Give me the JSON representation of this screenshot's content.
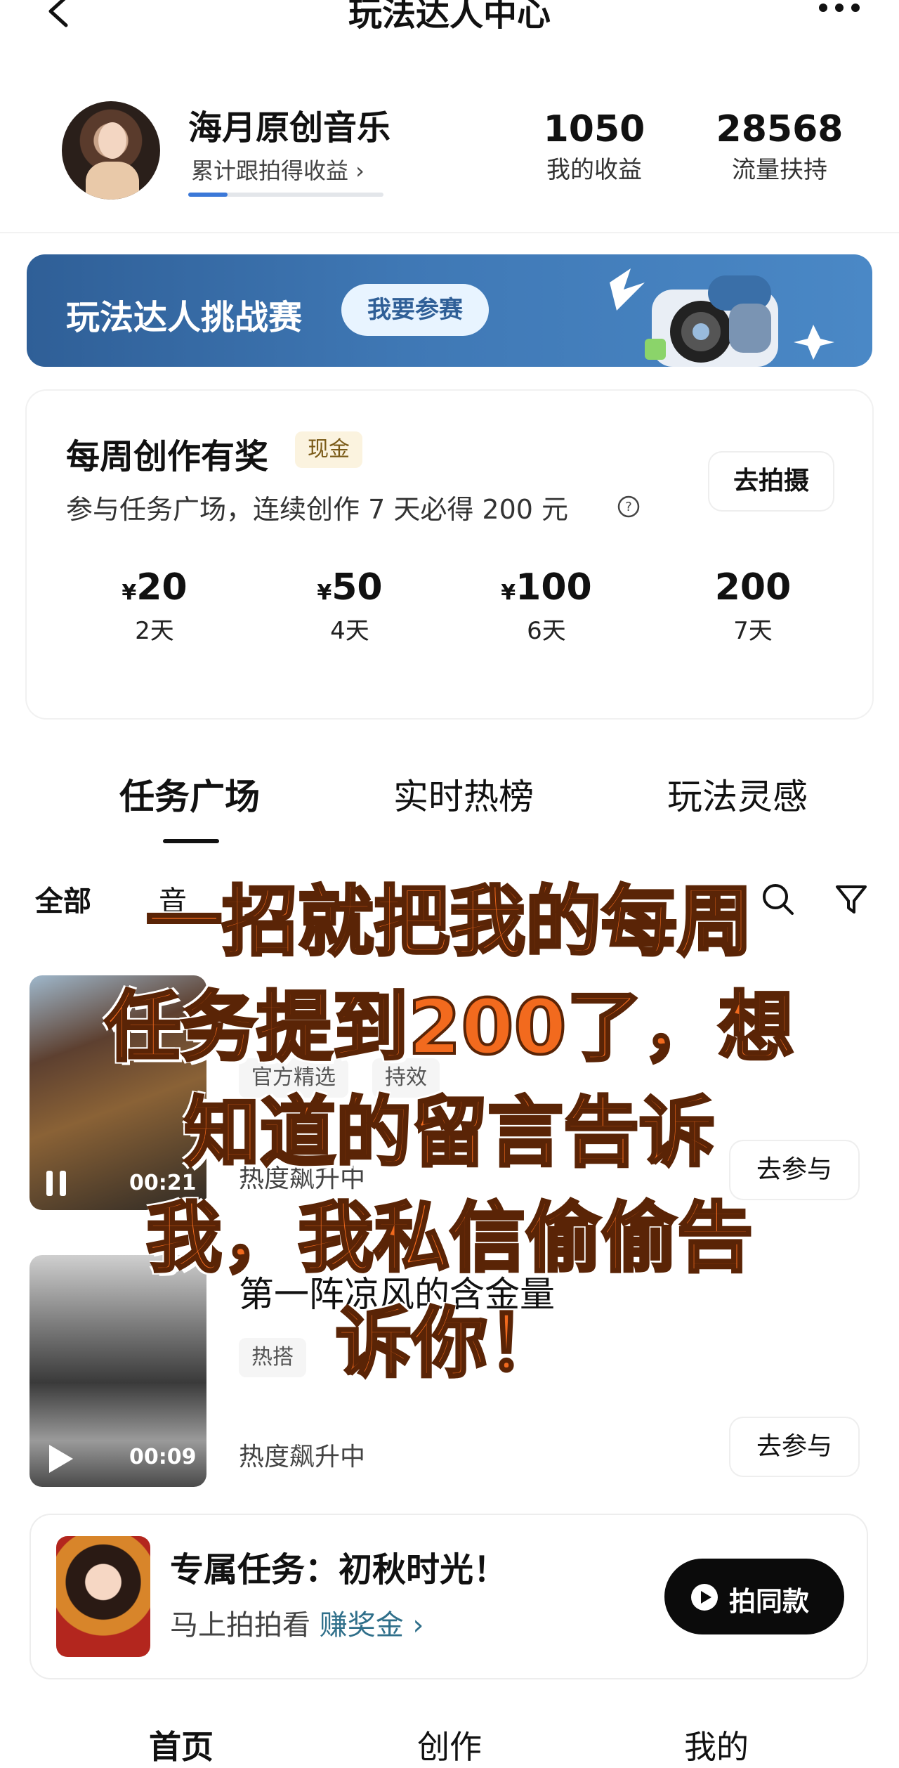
{
  "header": {
    "title": "玩法达人中心"
  },
  "profile": {
    "name": "海月原创音乐",
    "link": "累计跟拍得收益 ›",
    "progress": 0.2,
    "stats": [
      {
        "value": "1050",
        "label": "我的收益"
      },
      {
        "value": "28568",
        "label": "流量扶持"
      }
    ]
  },
  "banner": {
    "title": "玩法达人挑战赛",
    "button": "我要参赛"
  },
  "weekly": {
    "title": "每周创作有奖",
    "badge": "现金",
    "desc": "参与任务广场，连续创作 7 天必得 200 元",
    "button": "去拍摄",
    "rewards": [
      {
        "yen": "¥",
        "amount": "20",
        "days": "2天"
      },
      {
        "yen": "¥",
        "amount": "50",
        "days": "4天"
      },
      {
        "yen": "¥",
        "amount": "100",
        "days": "6天"
      },
      {
        "yen": "",
        "amount": "200",
        "days": "7天"
      }
    ]
  },
  "tabs": [
    {
      "label": "任务广场"
    },
    {
      "label": "实时热榜"
    },
    {
      "label": "玩法灵感"
    }
  ],
  "filters": {
    "first": "全部",
    "second": "音"
  },
  "items": [
    {
      "duration": "00:21",
      "tags": [
        "官方精选",
        "持效"
      ],
      "hot": "热度飙升中",
      "button": "去参与"
    },
    {
      "title": "第一阵凉风的含金量",
      "duration": "00:09",
      "tags": [
        "热搭"
      ],
      "hot": "热度飙升中",
      "button": "去参与"
    }
  ],
  "exclusive": {
    "title": "专属任务：初秋时光！",
    "sub": "马上拍拍看",
    "accent": "赚奖金 ›",
    "button": "拍同款"
  },
  "nav": [
    {
      "label": "首页"
    },
    {
      "label": "创作"
    },
    {
      "label": "我的"
    }
  ],
  "overlay": {
    "lines": [
      "一招就把我的每周",
      "任务提到200了，想",
      "知道的留言告诉",
      "我，我私信偷偷告",
      "诉你！"
    ]
  },
  "colors": {
    "accent_blue": "#3b78d8",
    "overlay_orange": "#f26a1e",
    "banner_blue": "#2f5f97"
  }
}
